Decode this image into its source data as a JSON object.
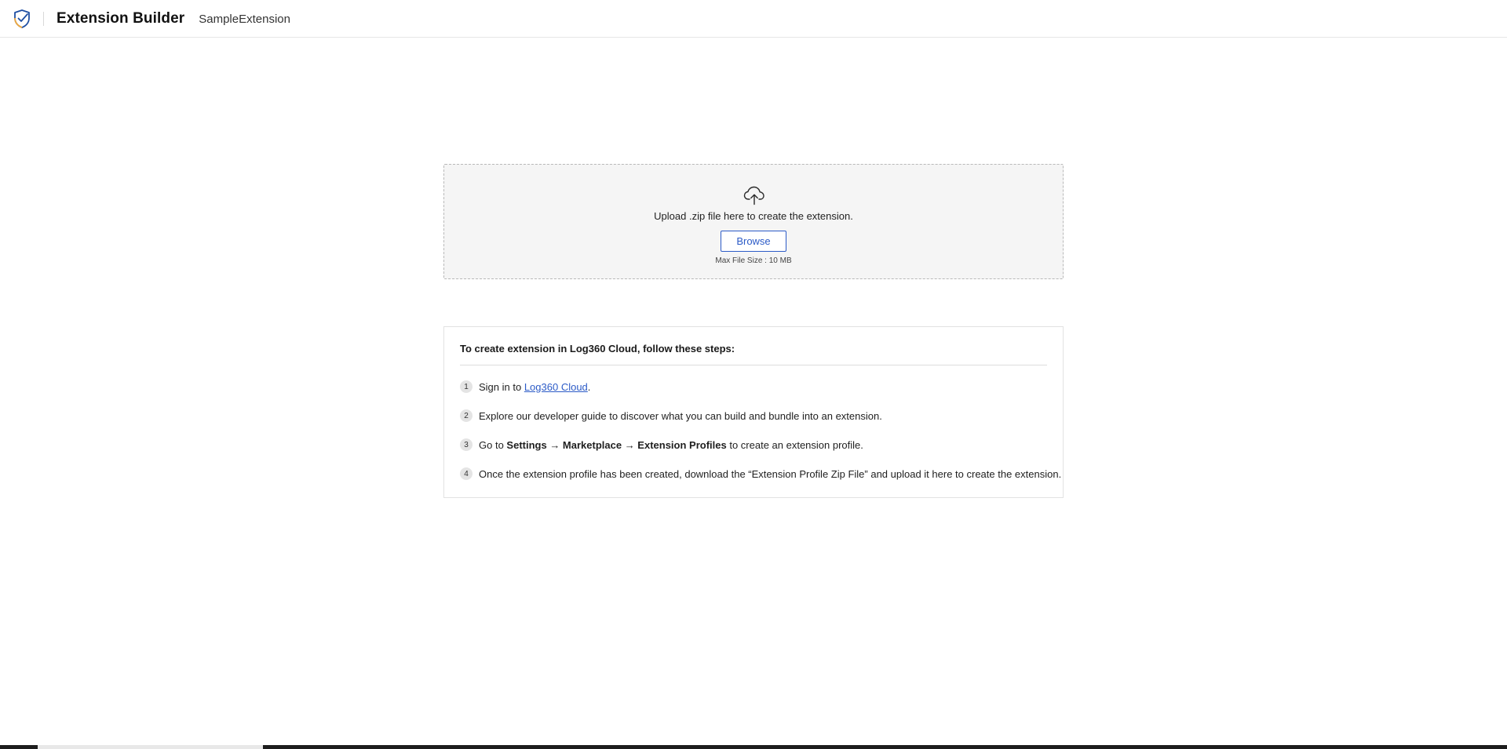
{
  "header": {
    "app_title": "Extension Builder",
    "project_name": "SampleExtension",
    "logo_icon": "shield-check-icon"
  },
  "upload": {
    "icon": "cloud-upload-icon",
    "instruction": "Upload .zip file here to create the extension.",
    "browse_label": "Browse",
    "max_size": "Max File Size : 10 MB"
  },
  "steps": {
    "heading": "To create extension in Log360 Cloud, follow these steps:",
    "items": [
      {
        "num": "1",
        "prefix": "Sign in to ",
        "link": "Log360 Cloud",
        "suffix": "."
      },
      {
        "num": "2",
        "text": "Explore our developer guide to discover what you can build and bundle into an extension."
      },
      {
        "num": "3",
        "prefix": "Go to ",
        "bold": "Settings → Marketplace → Extension Profiles",
        "suffix": " to create an extension profile."
      },
      {
        "num": "4",
        "text": "Once the extension profile has been created, download the “Extension Profile Zip File” and upload it here to create the extension."
      }
    ]
  },
  "colors": {
    "accent": "#2c5bc7",
    "logo_primary": "#1f4fa3",
    "logo_secondary": "#f2a93b",
    "dropzone_bg": "#f5f5f5"
  }
}
